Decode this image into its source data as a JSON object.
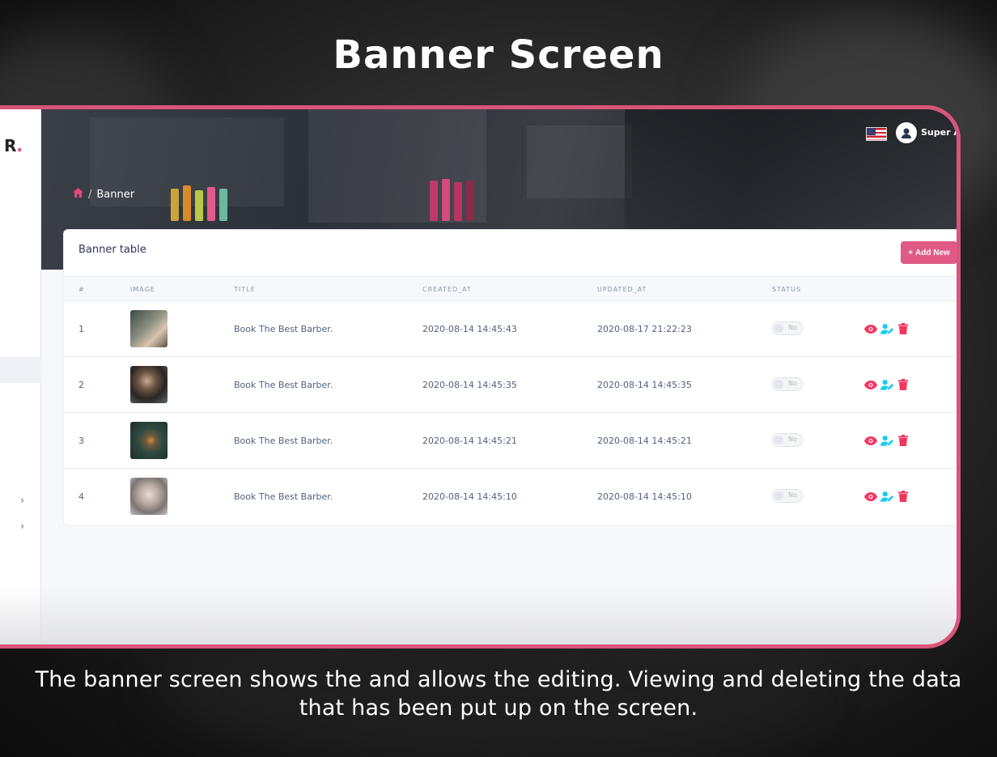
{
  "headline": "Banner Screen",
  "caption": "The banner screen shows the and allows the editing. Viewing and deleting the data that has been put up on the screen.",
  "app": {
    "logo_text": "R",
    "user_name": "Super Ad",
    "breadcrumb": {
      "current": "Banner"
    }
  },
  "table": {
    "title": "Banner table",
    "add_label": "Add New",
    "columns": [
      "#",
      "IMAGE",
      "TITLE",
      "CREATED_AT",
      "UPDATED_AT",
      "STATUS"
    ],
    "rows": [
      {
        "id": "1",
        "title": "Book The Best Barber.",
        "created_at": "2020-08-14 14:45:43",
        "updated_at": "2020-08-17 21:22:23",
        "status": "No"
      },
      {
        "id": "2",
        "title": "Book The Best Barber.",
        "created_at": "2020-08-14 14:45:35",
        "updated_at": "2020-08-14 14:45:35",
        "status": "No"
      },
      {
        "id": "3",
        "title": "Book The Best Barber.",
        "created_at": "2020-08-14 14:45:21",
        "updated_at": "2020-08-14 14:45:21",
        "status": "No"
      },
      {
        "id": "4",
        "title": "Book The Best Barber.",
        "created_at": "2020-08-14 14:45:10",
        "updated_at": "2020-08-14 14:45:10",
        "status": "No"
      }
    ]
  },
  "colors": {
    "accent": "#e05a85",
    "frame": "#d9547a",
    "view": "#f5365c",
    "edit": "#11cdef",
    "delete": "#f5365c"
  },
  "icons": {
    "home": "home-icon",
    "view": "eye-icon",
    "edit": "user-edit-icon",
    "delete": "trash-icon",
    "add": "plus-icon",
    "flag": "us-flag-icon"
  }
}
